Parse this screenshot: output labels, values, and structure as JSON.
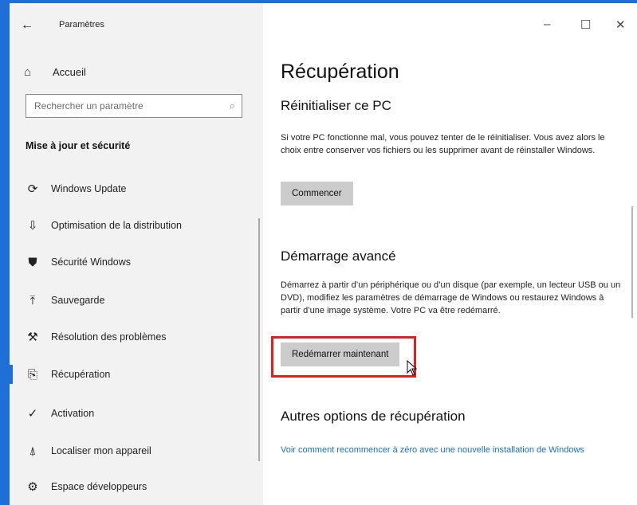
{
  "window": {
    "title": "Paramètres",
    "controls": {
      "minimize": "–",
      "maximize": "☐",
      "close": "✕"
    }
  },
  "sidebar": {
    "home_label": "Accueil",
    "search_placeholder": "Rechercher un paramètre",
    "section_title": "Mise à jour et sécurité",
    "items": [
      {
        "label": "Windows Update",
        "icon": "refresh-icon",
        "glyph": "⟳"
      },
      {
        "label": "Optimisation de la distribution",
        "icon": "delivery-icon",
        "glyph": "⇩"
      },
      {
        "label": "Sécurité Windows",
        "icon": "shield-icon",
        "glyph": "⛊"
      },
      {
        "label": "Sauvegarde",
        "icon": "backup-icon",
        "glyph": "⤒"
      },
      {
        "label": "Résolution des problèmes",
        "icon": "wrench-icon",
        "glyph": "⚒"
      },
      {
        "label": "Récupération",
        "icon": "recovery-icon",
        "glyph": "⎘",
        "selected": true
      },
      {
        "label": "Activation",
        "icon": "check-circle-icon",
        "glyph": "✓"
      },
      {
        "label": "Localiser mon appareil",
        "icon": "locate-icon",
        "glyph": "⍋"
      },
      {
        "label": "Espace développeurs",
        "icon": "developer-icon",
        "glyph": "⚙"
      }
    ]
  },
  "main": {
    "page_title": "Récupération",
    "reset": {
      "heading": "Réinitialiser ce PC",
      "text": "Si votre PC fonctionne mal, vous pouvez tenter de le réinitialiser. Vous avez alors le choix entre conserver vos fichiers ou les supprimer avant de réinstaller Windows.",
      "button": "Commencer"
    },
    "advanced": {
      "heading": "Démarrage avancé",
      "text": "Démarrez à partir d’un périphérique ou d’un disque (par exemple, un lecteur USB ou un DVD), modifiez les paramètres de démarrage de Windows ou restaurez Windows à partir d’une image système. Votre PC va être redémarré.",
      "button": "Redémarrer maintenant"
    },
    "other": {
      "heading": "Autres options de récupération",
      "link": "Voir comment recommencer à zéro avec une nouvelle installation de Windows"
    }
  },
  "colors": {
    "accent": "#1e6fd6",
    "highlight": "#e0201e",
    "link": "#1a6fc4",
    "sidebar_bg": "#f2f2f2",
    "button_bg": "#cccccc"
  }
}
